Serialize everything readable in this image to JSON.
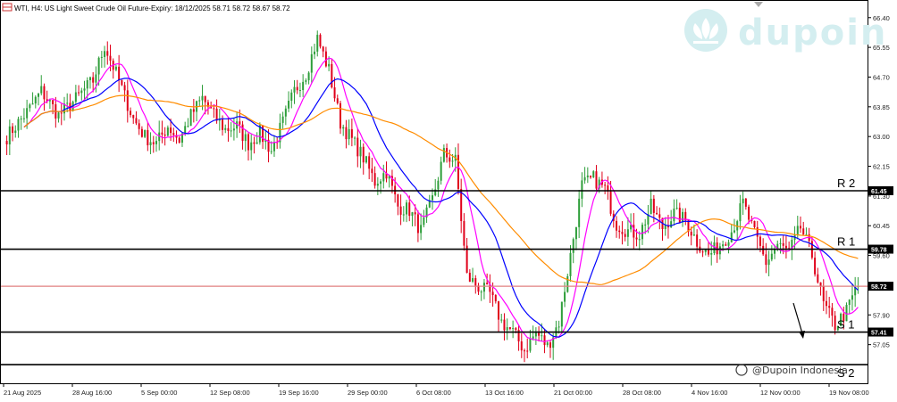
{
  "header": {
    "title": "WTI, H4:  US Light Sweet Crude Oil Future-Expiry: 18/12/2025  58.71 58.72 58.67 58.72"
  },
  "watermark": {
    "brand": "dupoin",
    "handle": "@Dupoin Indonesia"
  },
  "colors": {
    "bull": "#2e9e3a",
    "bear": "#e0001a",
    "ma_fast": "#ff00ff",
    "ma_mid": "#0000ff",
    "ma_slow": "#ff8c00",
    "level_line": "#000000",
    "tag_bg": "#000000",
    "price_line": "#e08080",
    "watermark": "#d4eef0"
  },
  "chart_data": {
    "type": "candlestick",
    "symbol": "WTI",
    "timeframe": "H4",
    "y_ticks": [
      "66.40",
      "65.55",
      "64.70",
      "63.85",
      "63.00",
      "62.15",
      "61.30",
      "60.45",
      "59.60",
      "57.90",
      "57.05"
    ],
    "ylim": [
      56.2,
      66.7
    ],
    "x_ticks": [
      "21 Aug 2025",
      "28 Aug 16:00",
      "5 Sep 00:00",
      "12 Sep 08:00",
      "19 Sep 16:00",
      "29 Sep 00:00",
      "6 Oct 08:00",
      "13 Oct 16:00",
      "21 Oct 00:00",
      "28 Oct 08:00",
      "4 Nov 16:00",
      "12 Nov 00:00",
      "19 Nov 08:00"
    ],
    "levels": [
      {
        "label": "R 2",
        "price": 61.45,
        "tag": "61.45"
      },
      {
        "label": "R 1",
        "price": 59.78,
        "tag": "59.78"
      },
      {
        "label": "S 1",
        "price": 57.41,
        "tag": "57.41"
      },
      {
        "label": "S 2",
        "price": 56.48,
        "tag": ""
      }
    ],
    "current_price": {
      "value": 58.72,
      "tag": "58.72"
    },
    "path_nodes": [
      [
        0,
        63.0
      ],
      [
        8,
        63.8
      ],
      [
        12,
        64.3
      ],
      [
        18,
        63.6
      ],
      [
        22,
        63.9
      ],
      [
        30,
        64.6
      ],
      [
        34,
        65.6
      ],
      [
        38,
        64.8
      ],
      [
        44,
        63.5
      ],
      [
        48,
        63.0
      ],
      [
        52,
        62.8
      ],
      [
        56,
        63.3
      ],
      [
        60,
        62.9
      ],
      [
        64,
        63.6
      ],
      [
        68,
        64.1
      ],
      [
        72,
        63.6
      ],
      [
        76,
        63.2
      ],
      [
        80,
        63.3
      ],
      [
        84,
        62.8
      ],
      [
        88,
        63.1
      ],
      [
        92,
        62.6
      ],
      [
        96,
        63.4
      ],
      [
        100,
        64.3
      ],
      [
        104,
        64.8
      ],
      [
        108,
        65.8
      ],
      [
        112,
        64.9
      ],
      [
        116,
        63.4
      ],
      [
        120,
        62.9
      ],
      [
        124,
        62.4
      ],
      [
        128,
        61.7
      ],
      [
        132,
        62.0
      ],
      [
        136,
        61.0
      ],
      [
        140,
        60.9
      ],
      [
        144,
        60.3
      ],
      [
        148,
        61.2
      ],
      [
        152,
        62.5
      ],
      [
        156,
        62.3
      ],
      [
        160,
        59.0
      ],
      [
        164,
        58.7
      ],
      [
        168,
        58.5
      ],
      [
        172,
        57.7
      ],
      [
        176,
        57.4
      ],
      [
        180,
        56.9
      ],
      [
        184,
        57.4
      ],
      [
        188,
        57.0
      ],
      [
        192,
        57.7
      ],
      [
        196,
        59.6
      ],
      [
        200,
        61.6
      ],
      [
        204,
        61.8
      ],
      [
        208,
        61.5
      ],
      [
        212,
        60.5
      ],
      [
        216,
        60.3
      ],
      [
        220,
        60.2
      ],
      [
        224,
        61.0
      ],
      [
        228,
        60.4
      ],
      [
        232,
        60.8
      ],
      [
        236,
        60.6
      ],
      [
        240,
        60.0
      ],
      [
        244,
        59.6
      ],
      [
        248,
        59.9
      ],
      [
        252,
        60.3
      ],
      [
        256,
        61.1
      ],
      [
        260,
        60.2
      ],
      [
        264,
        59.4
      ],
      [
        268,
        59.9
      ],
      [
        272,
        59.7
      ],
      [
        276,
        60.4
      ],
      [
        280,
        59.6
      ],
      [
        284,
        58.2
      ],
      [
        288,
        57.6
      ],
      [
        292,
        58.0
      ],
      [
        296,
        58.8
      ]
    ],
    "moving_averages": [
      {
        "key": "ma_fast",
        "period": 9
      },
      {
        "key": "ma_mid",
        "period": 20
      },
      {
        "key": "ma_slow",
        "period": 50
      }
    ],
    "annotation": "projected-move-down"
  }
}
